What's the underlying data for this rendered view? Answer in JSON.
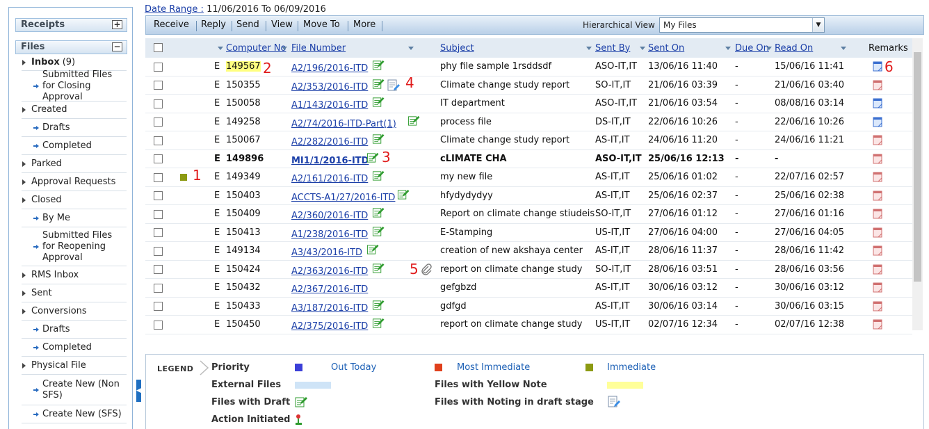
{
  "sidebar": {
    "receipts_label": "Receipts",
    "receipts_toggle": "+",
    "files_label": "Files",
    "files_toggle": "−",
    "items": [
      {
        "label": "Inbox",
        "count": "(9)",
        "type": "top"
      },
      {
        "label": "Submitted Files for Closing Approval",
        "type": "sub"
      },
      {
        "label": "Created",
        "type": "top"
      },
      {
        "label": "Drafts",
        "type": "sub"
      },
      {
        "label": "Completed",
        "type": "sub"
      },
      {
        "label": "Parked",
        "type": "top"
      },
      {
        "label": "Approval Requests",
        "type": "top"
      },
      {
        "label": "Closed",
        "type": "top"
      },
      {
        "label": "By Me",
        "type": "sub"
      },
      {
        "label": "Submitted Files for Reopening Approval",
        "type": "sub"
      },
      {
        "label": "RMS Inbox",
        "type": "top"
      },
      {
        "label": "Sent",
        "type": "top"
      },
      {
        "label": "Conversions",
        "type": "top"
      },
      {
        "label": "Drafts",
        "type": "sub"
      },
      {
        "label": "Completed",
        "type": "sub"
      },
      {
        "label": "Physical File",
        "type": "top"
      },
      {
        "label": "Create New (Non SFS)",
        "type": "sub"
      },
      {
        "label": "Create New (SFS)",
        "type": "sub"
      }
    ]
  },
  "date_range": {
    "label": "Date Range :",
    "value": "11/06/2016 To 06/09/2016"
  },
  "toolbar": {
    "buttons": [
      "Receive",
      "Reply",
      "Send",
      "View",
      "Move To",
      "More"
    ],
    "hierarchical_label": "Hierarchical View",
    "hierarchical_value": "My Files"
  },
  "columns": {
    "computer_no": "Computer No",
    "file_number": "File Number",
    "subject": "Subject",
    "sent_by": "Sent By",
    "sent_on": "Sent On",
    "due_on": "Due On",
    "read_on": "Read On",
    "remarks": "Remarks"
  },
  "rows": [
    {
      "type": "E",
      "computer_no": "149567",
      "file_number": "A2/196/2016-ITD",
      "subject": "phy file sample 1rsddsdf",
      "sent_by": "ASO-IT,IT",
      "sent_on": "13/06/16 11:40",
      "due_on": "-",
      "read_on": "15/06/16 11:41",
      "remark": "blue",
      "highlight": true,
      "draft": true
    },
    {
      "type": "E",
      "computer_no": "150355",
      "file_number": "A2/353/2016-ITD",
      "subject": "Climate change study report",
      "sent_by": "SO-IT,IT",
      "sent_on": "21/06/16 03:39",
      "due_on": "-",
      "read_on": "21/06/16 03:40",
      "remark": "red",
      "draft": true,
      "noting": true
    },
    {
      "type": "E",
      "computer_no": "150058",
      "file_number": "A1/143/2016-ITD",
      "subject": "IT department",
      "sent_by": "ASO-IT,IT",
      "sent_on": "21/06/16 03:54",
      "due_on": "-",
      "read_on": "08/08/16 03:14",
      "remark": "blue",
      "draft": true
    },
    {
      "type": "E",
      "computer_no": "149258",
      "file_number": "A2/74/2016-ITD-Part(1)",
      "subject": "process file",
      "sent_by": "DS-IT,IT",
      "sent_on": "22/06/16 10:26",
      "due_on": "-",
      "read_on": "22/06/16 10:26",
      "remark": "blue",
      "draft": true
    },
    {
      "type": "E",
      "computer_no": "150067",
      "file_number": "A2/282/2016-ITD",
      "subject": "Climate change study report",
      "sent_by": "AS-IT,IT",
      "sent_on": "24/06/16 11:20",
      "due_on": "-",
      "read_on": "24/06/16 11:21",
      "remark": "red",
      "draft": true
    },
    {
      "type": "E",
      "computer_no": "149896",
      "file_number": "MI1/1/2016-ITD",
      "subject": "cLIMATE CHA",
      "sent_by": "ASO-IT,IT",
      "sent_on": "25/06/16 12:13",
      "due_on": "-",
      "read_on": "-",
      "remark": "red",
      "bold": true,
      "draft": true
    },
    {
      "type": "E",
      "computer_no": "149349",
      "file_number": "A2/161/2016-ITD",
      "subject": "my new file",
      "sent_by": "AS-IT,IT",
      "sent_on": "25/06/16 01:02",
      "due_on": "-",
      "read_on": "22/07/16 02:57",
      "remark": "red",
      "priority": "#8c9a12",
      "draft": true
    },
    {
      "type": "E",
      "computer_no": "150403",
      "file_number": "ACCTS-A1/27/2016-ITD",
      "subject": "hfydydydyy",
      "sent_by": "AS-IT,IT",
      "sent_on": "25/06/16 02:37",
      "due_on": "-",
      "read_on": "25/06/16 02:38",
      "remark": "red",
      "draft": true
    },
    {
      "type": "E",
      "computer_no": "150409",
      "file_number": "A2/360/2016-ITD",
      "subject": "Report on climate change stiudeis",
      "sent_by": "SO-IT,IT",
      "sent_on": "27/06/16 01:12",
      "due_on": "-",
      "read_on": "27/06/16 01:16",
      "remark": "red",
      "draft": true
    },
    {
      "type": "E",
      "computer_no": "150413",
      "file_number": "A1/238/2016-ITD",
      "subject": "E-Stamping",
      "sent_by": "US-IT,IT",
      "sent_on": "27/06/16 04:00",
      "due_on": "-",
      "read_on": "27/06/16 04:05",
      "remark": "red",
      "draft": true
    },
    {
      "type": "E",
      "computer_no": "149134",
      "file_number": "A3/43/2016-ITD",
      "subject": "creation of new akshaya center",
      "sent_by": "AS-IT,IT",
      "sent_on": "28/06/16 11:37",
      "due_on": "-",
      "read_on": "28/06/16 11:42",
      "remark": "red",
      "draft": true
    },
    {
      "type": "E",
      "computer_no": "150424",
      "file_number": "A2/363/2016-ITD",
      "subject": "report on climate change study",
      "sent_by": "SO-IT,IT",
      "sent_on": "28/06/16 03:51",
      "due_on": "-",
      "read_on": "28/06/16 03:56",
      "remark": "red",
      "draft": true,
      "attach": true
    },
    {
      "type": "E",
      "computer_no": "150432",
      "file_number": "A2/367/2016-ITD",
      "subject": "gefgbzd",
      "sent_by": "AS-IT,IT",
      "sent_on": "30/06/16 03:12",
      "due_on": "-",
      "read_on": "30/06/16 03:12",
      "remark": "red"
    },
    {
      "type": "E",
      "computer_no": "150433",
      "file_number": "A3/187/2016-ITD",
      "subject": "gdfgd",
      "sent_by": "AS-IT,IT",
      "sent_on": "30/06/16 03:14",
      "due_on": "-",
      "read_on": "30/06/16 03:15",
      "remark": "red",
      "draft": true
    },
    {
      "type": "E",
      "computer_no": "150450",
      "file_number": "A2/375/2016-ITD",
      "subject": "report on climate change study",
      "sent_by": "US-IT,IT",
      "sent_on": "02/07/16 12:34",
      "due_on": "-",
      "read_on": "02/07/16 12:38",
      "remark": "red",
      "draft": true
    }
  ],
  "annotations": [
    "1",
    "2",
    "3",
    "4",
    "5",
    "6"
  ],
  "legend": {
    "title": "LEGEND",
    "priority": "Priority",
    "out_today": "Out Today",
    "most_immediate": "Most Immediate",
    "immediate": "Immediate",
    "external_files": "External Files",
    "yellow_note": "Files with Yellow Note",
    "files_with_draft": "Files with Draft",
    "noting_draft": "Files with Noting in draft stage",
    "action_initiated": "Action Initiated",
    "colors": {
      "out_today": "#3b3fd8",
      "most_immediate": "#e0401c",
      "immediate": "#8c9a12",
      "external": "#cfe4f7",
      "yellow": "#ffff99"
    }
  }
}
